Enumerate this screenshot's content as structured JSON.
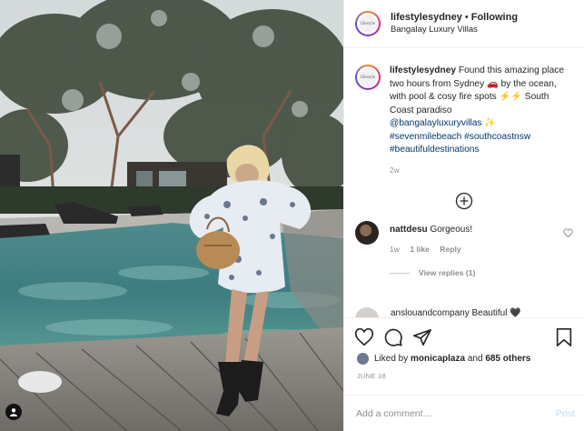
{
  "header": {
    "username": "lifestylesydney",
    "separator": "•",
    "follow_state": "Following",
    "location": "Bangalay Luxury Villas"
  },
  "avatar_text": "lifestyle",
  "caption": {
    "username": "lifestylesydney",
    "text": "Found this amazing place two hours from Sydney 🚗 by the ocean, with pool & cosy fire spots ⚡⚡ South Coast paradiso",
    "mention": "@bangalayluxuryvillas",
    "mention_suffix": "✨",
    "hashtags": "#sevenmilebeach #southcoastnsw #beautifuldestinations",
    "time": "2w"
  },
  "comment": {
    "username": "nattdesu",
    "text": "Gorgeous!",
    "time": "1w",
    "likes": "1 like",
    "reply": "Reply",
    "view_replies": "View replies (1)"
  },
  "next_comment_preview": "anslouandcompany Beautiful 🖤",
  "likes": {
    "prefix": "Liked by",
    "user": "monicaplaza",
    "and": "and",
    "others": "685 others"
  },
  "date": "JUNE 18",
  "add_comment": {
    "placeholder": "Add a comment…",
    "post_label": "Post"
  },
  "icons": [
    "heart-icon",
    "comment-icon",
    "share-icon",
    "bookmark-icon",
    "plus-circle-icon",
    "user-tag-icon"
  ],
  "colors": {
    "link": "#00376b",
    "muted": "#8e8e8e",
    "post_disabled": "#b2dffc"
  }
}
